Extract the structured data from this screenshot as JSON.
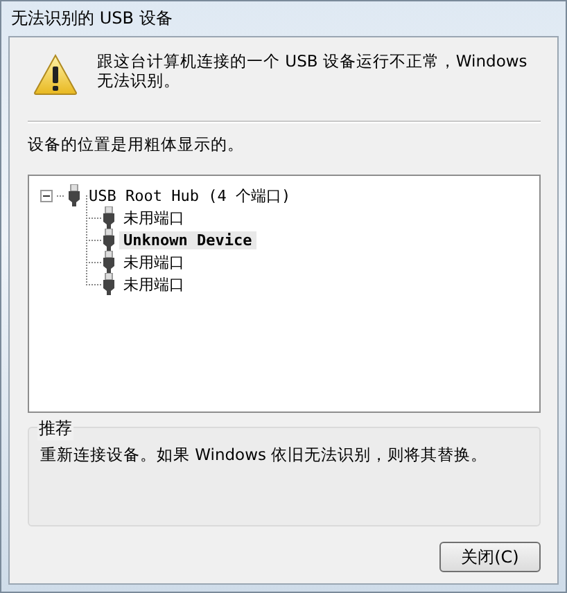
{
  "window": {
    "title": "无法识别的 USB 设备"
  },
  "message": "跟这台计算机连接的一个 USB 设备运行不正常，Windows 无法识别。",
  "hint": "设备的位置是用粗体显示的。",
  "tree": [
    {
      "label": "USB Root Hub (4 个端口)",
      "expanded": true,
      "selected": false,
      "children": [
        {
          "label": "未用端口",
          "selected": false
        },
        {
          "label": "Unknown Device",
          "selected": true
        },
        {
          "label": "未用端口",
          "selected": false
        },
        {
          "label": "未用端口",
          "selected": false
        }
      ]
    }
  ],
  "recommendation": {
    "title": "推荐",
    "text": "重新连接设备。如果 Windows 依旧无法识别，则将其替换。"
  },
  "buttons": [
    {
      "label": "关闭(C)"
    }
  ]
}
